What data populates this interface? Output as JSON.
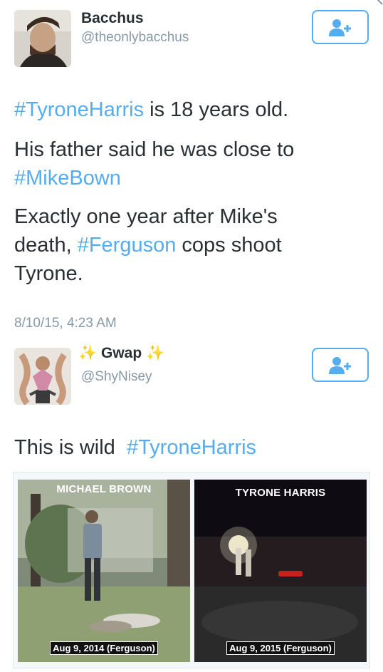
{
  "top_icon": "close-icon",
  "tweet1": {
    "user_name": "Bacchus",
    "handle": "@theonlybacchus",
    "follow_icon": "add-user-icon",
    "line1_tag": "#TyroneHarris",
    "line1_rest": " is 18 years old.",
    "line2": "His father said he was close to",
    "line2_tag": "#MikeBown",
    "line3_a": "Exactly one year after Mike's",
    "line3_b": "death, ",
    "line3_tag": "#Ferguson",
    "line3_c": " cops shoot",
    "line3_d": "Tyrone.",
    "timestamp": "8/10/15, 4:23 AM"
  },
  "tweet2": {
    "name_sparkle_left": "✨",
    "user_name": "Gwap",
    "name_sparkle_right": "✨",
    "handle": "@ShyNisey",
    "follow_icon": "add-user-icon",
    "text": "This is wild",
    "text_tag": "#TyroneHarris",
    "media": {
      "left_title": "MICHAEL BROWN",
      "left_caption": "Aug 9, 2014 (Ferguson)",
      "right_title": "TYRONE HARRIS",
      "right_caption": "Aug 9, 2015 (Ferguson)"
    }
  },
  "colors": {
    "link": "#55acee",
    "text": "#292f33",
    "muted": "#8899a6"
  }
}
